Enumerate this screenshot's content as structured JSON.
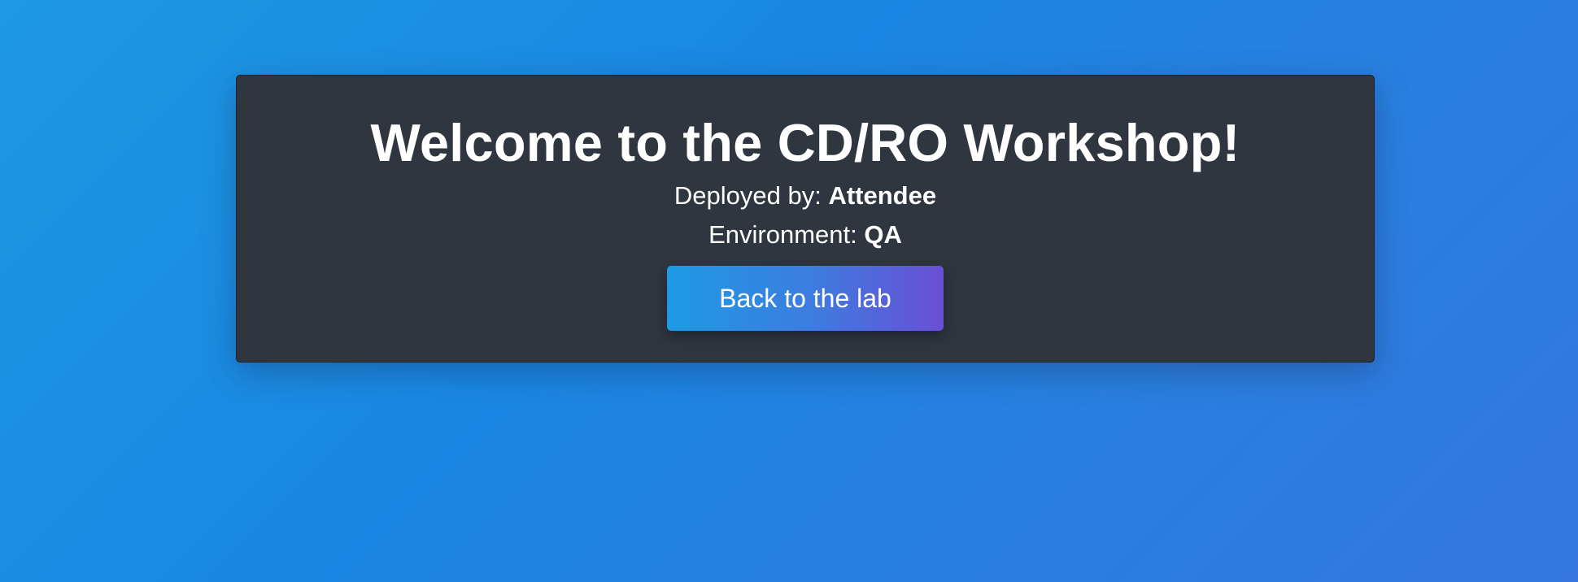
{
  "card": {
    "title": "Welcome to the CD/RO Workshop!",
    "deployed_by": {
      "label": "Deployed by: ",
      "value": "Attendee"
    },
    "environment": {
      "label": "Environment: ",
      "value": "QA"
    },
    "back_button_label": "Back to the lab"
  },
  "colors": {
    "background_start": "#1e98e2",
    "background_end": "#3376df",
    "card_background": "#2f3640",
    "button_gradient_start": "#1e9ae3",
    "button_gradient_end": "#6a4fd3",
    "text": "#ffffff"
  }
}
